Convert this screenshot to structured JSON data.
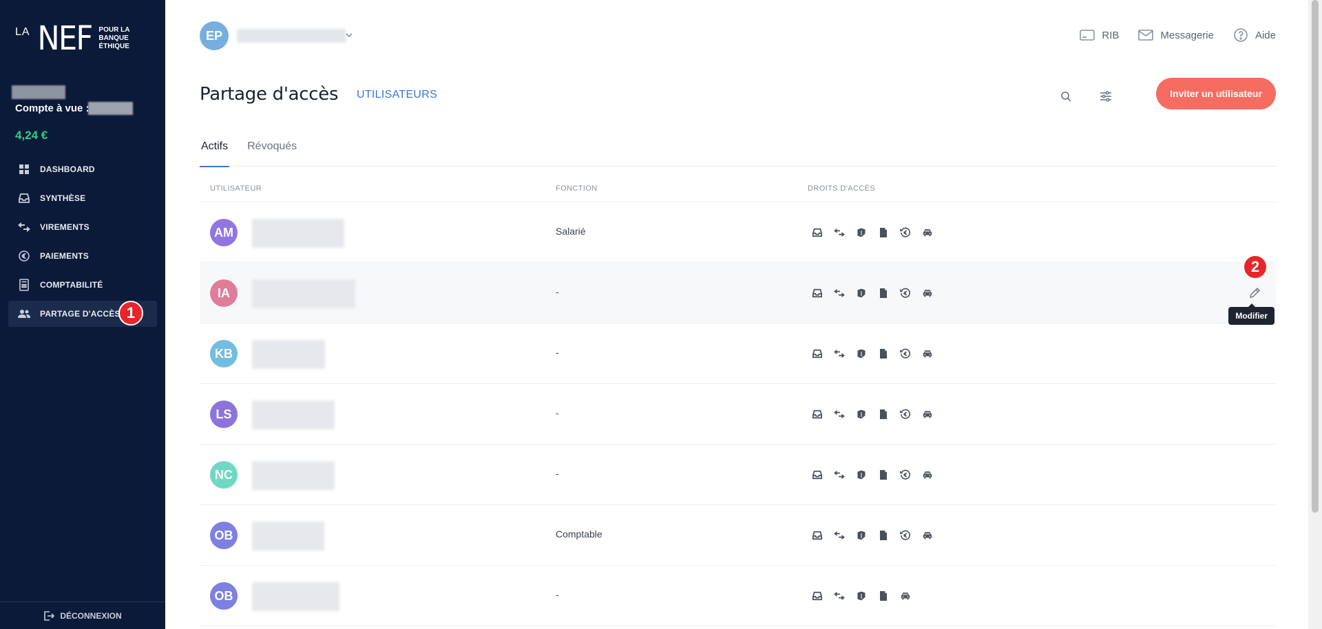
{
  "brand": {
    "la": "LA",
    "nef": "NEF",
    "tagline_1": "POUR LA",
    "tagline_2": "BANQUE",
    "tagline_3": "ÉTHIQUE"
  },
  "account": {
    "label": "Compte à vue :",
    "balance": "4,24 €"
  },
  "sidebar": {
    "items": [
      {
        "label": "DASHBOARD",
        "icon": "grid-icon"
      },
      {
        "label": "SYNTHÈSE",
        "icon": "inbox-icon"
      },
      {
        "label": "VIREMENTS",
        "icon": "transfer-icon"
      },
      {
        "label": "PAIEMENTS",
        "icon": "euro-icon"
      },
      {
        "label": "COMPTABILITÉ",
        "icon": "calculator-icon"
      },
      {
        "label": "PARTAGE D'ACCÈS",
        "icon": "users-icon",
        "active": true,
        "badge": "1"
      }
    ],
    "logout": "DÉCONNEXION"
  },
  "topbar": {
    "user_initials": "EP",
    "actions": [
      {
        "label": "RIB",
        "icon": "card-icon"
      },
      {
        "label": "Messagerie",
        "icon": "mail-icon"
      },
      {
        "label": "Aide",
        "icon": "help-icon"
      }
    ]
  },
  "page": {
    "title": "Partage d'accès",
    "subtitle": "UTILISATEURS",
    "invite_label": "Inviter un utilisateur",
    "tabs": [
      {
        "label": "Actifs",
        "active": true
      },
      {
        "label": "Révoqués",
        "active": false
      }
    ]
  },
  "table": {
    "headers": {
      "user": "UTILISATEUR",
      "function": "FONCTION",
      "rights": "DROITS D'ACCÈS"
    },
    "rows": [
      {
        "initials": "AM",
        "color": "#8f76e0",
        "function": "Salarié",
        "rights": 6
      },
      {
        "initials": "IA",
        "color": "#e07d9b",
        "function": "-",
        "rights": 6,
        "hover": true,
        "badge": "2",
        "tooltip": "Modifier"
      },
      {
        "initials": "KB",
        "color": "#72bde0",
        "function": "-",
        "rights": 6
      },
      {
        "initials": "LS",
        "color": "#8d74dd",
        "function": "-",
        "rights": 6
      },
      {
        "initials": "NC",
        "color": "#6fd8c2",
        "function": "-",
        "rights": 6
      },
      {
        "initials": "OB",
        "color": "#7d80e0",
        "function": "Comptable",
        "rights": 6
      },
      {
        "initials": "OB",
        "color": "#7d80e0",
        "function": "-",
        "rights": 5
      }
    ]
  }
}
